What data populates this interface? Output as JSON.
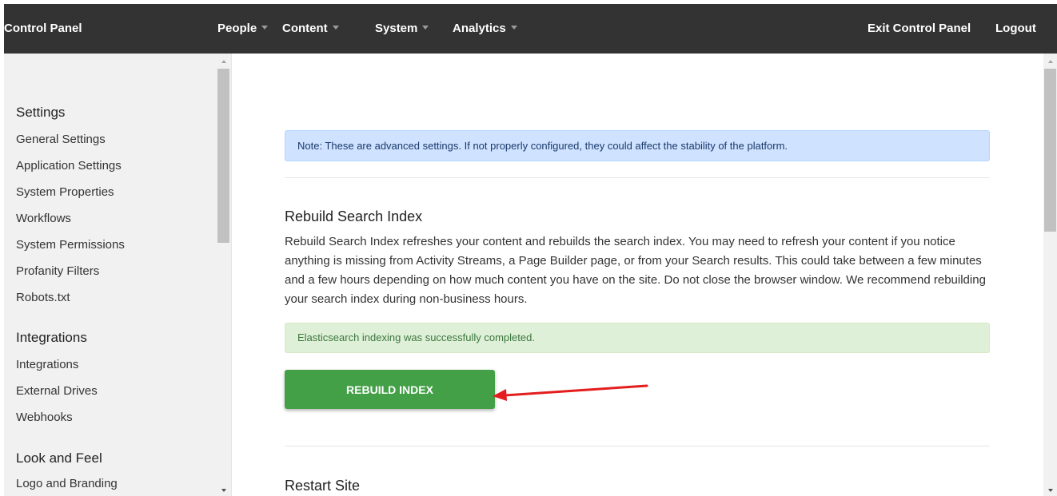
{
  "topbar": {
    "brand": "Control Panel",
    "nav": [
      {
        "label": "People"
      },
      {
        "label": "Content"
      },
      {
        "label": "System"
      },
      {
        "label": "Analytics"
      }
    ],
    "exit_label": "Exit Control Panel",
    "logout_label": "Logout"
  },
  "sidebar": {
    "sections": [
      {
        "heading": "Settings",
        "items": [
          "General Settings",
          "Application Settings",
          "System Properties",
          "Workflows",
          "System Permissions",
          "Profanity Filters",
          "Robots.txt"
        ]
      },
      {
        "heading": "Integrations",
        "items": [
          "Integrations",
          "External Drives",
          "Webhooks"
        ]
      },
      {
        "heading": "Look and Feel",
        "items": [
          "Logo and Branding"
        ]
      }
    ]
  },
  "main": {
    "note": "Note: These are advanced settings. If not properly configured, they could affect the stability of the platform.",
    "rebuild_title": "Rebuild Search Index",
    "rebuild_desc": "Rebuild Search Index refreshes your content and rebuilds the search index. You may need to refresh your content if you notice anything is missing from Activity Streams, a Page Builder page, or from your Search results. This could take between a few minutes and a few hours depending on how much content you have on the site. Do not close the browser window. We recommend rebuilding your search index during non-business hours.",
    "success": "Elasticsearch indexing was successfully completed.",
    "rebuild_button": "REBUILD INDEX",
    "restart_title": "Restart Site"
  },
  "colors": {
    "topbar": "#333333",
    "button": "#43a047",
    "info_bg": "#cfe2ff",
    "success_bg": "#dff0d8",
    "annotation_arrow": "#e41e1e"
  },
  "icons": [
    "caret-down-icon",
    "scroll-up-arrow-icon",
    "scroll-down-arrow-icon",
    "annotation-arrow"
  ]
}
